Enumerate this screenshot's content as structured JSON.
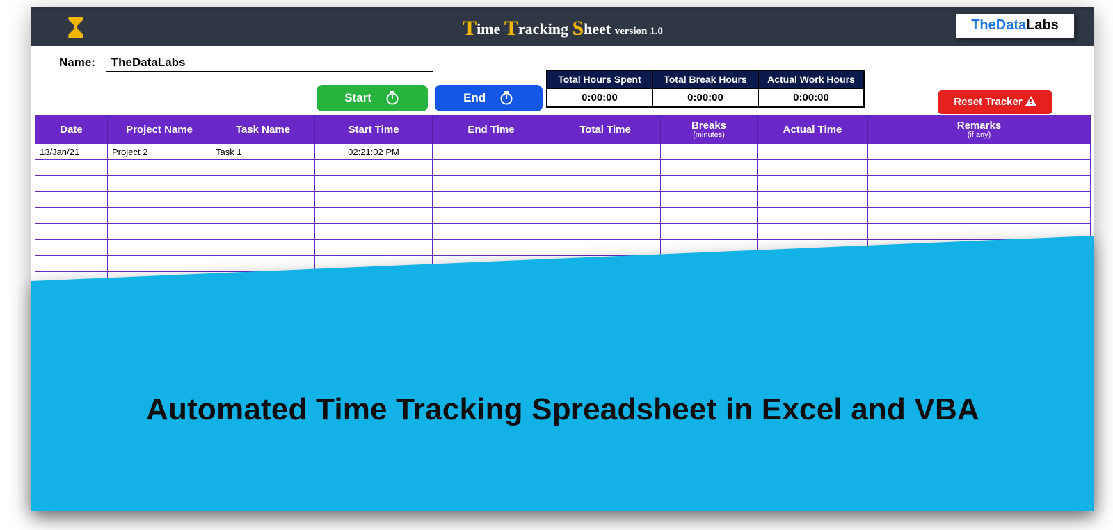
{
  "header": {
    "title_cap1": "T",
    "title_w1": "ime ",
    "title_cap2": "T",
    "title_w2": "racking ",
    "title_cap3": "S",
    "title_w3": "heet ",
    "version": "version 1.0",
    "logo_part1": "TheData",
    "logo_part2": "Labs"
  },
  "name": {
    "label": "Name:",
    "value": "TheDataLabs"
  },
  "summary": {
    "total_hours_label": "Total Hours Spent",
    "total_break_label": "Total Break Hours",
    "actual_work_label": "Actual Work Hours",
    "total_hours_value": "0:00:00",
    "total_break_value": "0:00:00",
    "actual_work_value": "0:00:00"
  },
  "buttons": {
    "start": "Start",
    "end": "End",
    "reset": "Reset Tracker"
  },
  "columns": {
    "date": "Date",
    "project": "Project Name",
    "task": "Task Name",
    "start": "Start Time",
    "end": "End Time",
    "total": "Total Time",
    "breaks": "Breaks",
    "breaks_sub": "(minutes)",
    "actual": "Actual Time",
    "remarks": "Remarks",
    "remarks_sub": "(if any)"
  },
  "rows": [
    {
      "date": "13/Jan/21",
      "project": "Project 2",
      "task": "Task 1",
      "start": "02:21:02 PM",
      "end": "",
      "total": "",
      "breaks": "",
      "actual": "",
      "remarks": ""
    },
    {
      "date": "",
      "project": "",
      "task": "",
      "start": "",
      "end": "",
      "total": "",
      "breaks": "",
      "actual": "",
      "remarks": ""
    },
    {
      "date": "",
      "project": "",
      "task": "",
      "start": "",
      "end": "",
      "total": "",
      "breaks": "",
      "actual": "",
      "remarks": ""
    },
    {
      "date": "",
      "project": "",
      "task": "",
      "start": "",
      "end": "",
      "total": "",
      "breaks": "",
      "actual": "",
      "remarks": ""
    },
    {
      "date": "",
      "project": "",
      "task": "",
      "start": "",
      "end": "",
      "total": "",
      "breaks": "",
      "actual": "",
      "remarks": ""
    },
    {
      "date": "",
      "project": "",
      "task": "",
      "start": "",
      "end": "",
      "total": "",
      "breaks": "",
      "actual": "",
      "remarks": ""
    },
    {
      "date": "",
      "project": "",
      "task": "",
      "start": "",
      "end": "",
      "total": "",
      "breaks": "",
      "actual": "",
      "remarks": ""
    },
    {
      "date": "",
      "project": "",
      "task": "",
      "start": "",
      "end": "",
      "total": "",
      "breaks": "",
      "actual": "",
      "remarks": ""
    },
    {
      "date": "",
      "project": "",
      "task": "",
      "start": "",
      "end": "",
      "total": "",
      "breaks": "",
      "actual": "",
      "remarks": ""
    }
  ],
  "selected_cell": {
    "row": 8,
    "col": "end"
  },
  "overlay": {
    "color": "#12b2e6",
    "caption": "Automated Time Tracking Spreadsheet in Excel and VBA"
  }
}
